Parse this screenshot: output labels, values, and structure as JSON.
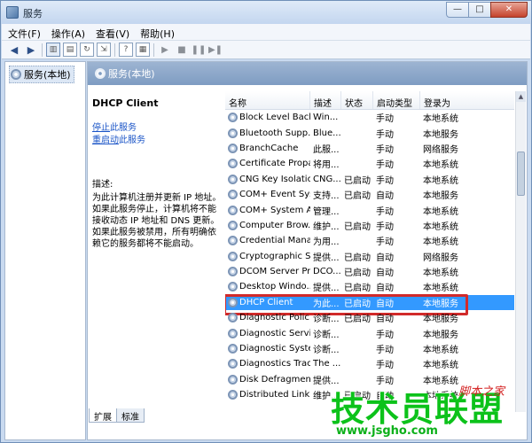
{
  "window": {
    "title": "服务"
  },
  "menu": [
    "文件(F)",
    "操作(A)",
    "查看(V)",
    "帮助(H)"
  ],
  "tree": {
    "root": "服务(本地)"
  },
  "panel": {
    "header": "服务(本地)",
    "service_title": "DHCP Client",
    "stop_link_u": "停止",
    "stop_link_rest": "此服务",
    "restart_link_u": "重启动",
    "restart_link_rest": "此服务",
    "desc_label": "描述:",
    "desc_text": "为此计算机注册并更新 IP 地址。如果此服务停止，计算机将不能接收动态 IP 地址和 DNS 更新。如果此服务被禁用，所有明确依赖它的服务都将不能启动。"
  },
  "columns": [
    "名称",
    "描述",
    "状态",
    "启动类型",
    "登录为"
  ],
  "services": [
    {
      "name": "Block Level Back...",
      "desc": "Win...",
      "status": "",
      "startup": "手动",
      "logon": "本地系统"
    },
    {
      "name": "Bluetooth Supp...",
      "desc": "Blue...",
      "status": "",
      "startup": "手动",
      "logon": "本地服务"
    },
    {
      "name": "BranchCache",
      "desc": "此服...",
      "status": "",
      "startup": "手动",
      "logon": "网络服务"
    },
    {
      "name": "Certificate Propa...",
      "desc": "将用...",
      "status": "",
      "startup": "手动",
      "logon": "本地系统"
    },
    {
      "name": "CNG Key Isolation",
      "desc": "CNG...",
      "status": "已启动",
      "startup": "手动",
      "logon": "本地系统"
    },
    {
      "name": "COM+ Event Sys...",
      "desc": "支持...",
      "status": "已启动",
      "startup": "自动",
      "logon": "本地服务"
    },
    {
      "name": "COM+ System A...",
      "desc": "管理...",
      "status": "",
      "startup": "手动",
      "logon": "本地系统"
    },
    {
      "name": "Computer Brow...",
      "desc": "维护...",
      "status": "已启动",
      "startup": "手动",
      "logon": "本地系统"
    },
    {
      "name": "Credential Mana...",
      "desc": "为用...",
      "status": "",
      "startup": "手动",
      "logon": "本地系统"
    },
    {
      "name": "Cryptographic S...",
      "desc": "提供...",
      "status": "已启动",
      "startup": "自动",
      "logon": "网络服务"
    },
    {
      "name": "DCOM Server Pr...",
      "desc": "DCO...",
      "status": "已启动",
      "startup": "自动",
      "logon": "本地系统"
    },
    {
      "name": "Desktop Windo...",
      "desc": "提供...",
      "status": "已启动",
      "startup": "自动",
      "logon": "本地系统"
    },
    {
      "name": "DHCP Client",
      "desc": "为此...",
      "status": "已启动",
      "startup": "自动",
      "logon": "本地服务",
      "selected": true
    },
    {
      "name": "Diagnostic Polic...",
      "desc": "诊断...",
      "status": "已启动",
      "startup": "自动",
      "logon": "本地服务"
    },
    {
      "name": "Diagnostic Servi...",
      "desc": "诊断...",
      "status": "",
      "startup": "手动",
      "logon": "本地服务"
    },
    {
      "name": "Diagnostic Syste...",
      "desc": "诊断...",
      "status": "",
      "startup": "手动",
      "logon": "本地系统"
    },
    {
      "name": "Diagnostics Trac...",
      "desc": "The ...",
      "status": "",
      "startup": "手动",
      "logon": "本地系统"
    },
    {
      "name": "Disk Defragmen...",
      "desc": "提供...",
      "status": "",
      "startup": "手动",
      "logon": "本地系统"
    },
    {
      "name": "Distributed Link ...",
      "desc": "维护...",
      "status": "已启动",
      "startup": "自动",
      "logon": "本地系统"
    }
  ],
  "tabs": [
    "扩展",
    "标准"
  ],
  "watermark": {
    "brand": "技术员联盟",
    "tagline": "脚本之家",
    "url": "www.jsgho.com"
  },
  "colors": {
    "selection": "#3399ff",
    "highlight_box": "#d12a2a",
    "watermark": "#0cc21a"
  }
}
